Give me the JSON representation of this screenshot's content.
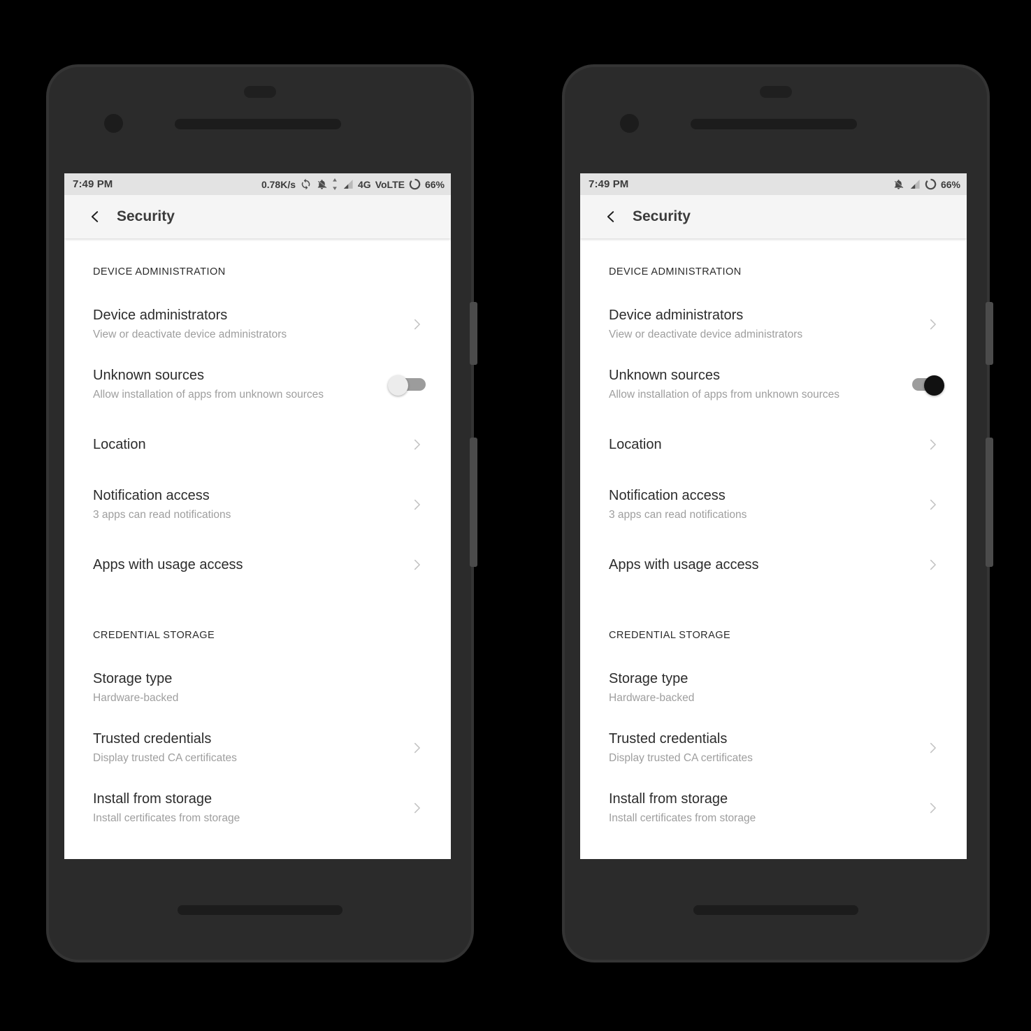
{
  "phones": [
    {
      "id": "phone-left",
      "status_bar": {
        "time": "7:49 PM",
        "data_speed": "0.78K/s",
        "network": "4G",
        "volte": "VoLTE",
        "battery": "66%",
        "icons": [
          "sync-icon",
          "bell-muted-icon",
          "data-arrows-icon",
          "signal-icon",
          "battery-icon"
        ]
      },
      "app_bar": {
        "back": "back-icon",
        "title": "Security"
      },
      "unknown_sources_enabled": false
    },
    {
      "id": "phone-right",
      "status_bar": {
        "time": "7:49 PM",
        "data_speed": "",
        "network": "",
        "volte": "",
        "battery": "66%",
        "icons": [
          "bell-muted-icon",
          "signal-icon",
          "battery-icon"
        ]
      },
      "app_bar": {
        "back": "back-icon",
        "title": "Security"
      },
      "unknown_sources_enabled": true
    }
  ],
  "sections": [
    {
      "header": "DEVICE ADMINISTRATION",
      "rows": [
        {
          "title": "Device administrators",
          "subtitle": "View or deactivate device administrators",
          "accessory": "chevron"
        },
        {
          "title": "Unknown sources",
          "subtitle": "Allow installation of apps from unknown sources",
          "accessory": "toggle"
        },
        {
          "title": "Location",
          "subtitle": "",
          "accessory": "chevron"
        },
        {
          "title": "Notification access",
          "subtitle": "3 apps can read notifications",
          "accessory": "chevron"
        },
        {
          "title": "Apps with usage access",
          "subtitle": "",
          "accessory": "chevron"
        }
      ]
    },
    {
      "header": "CREDENTIAL STORAGE",
      "rows": [
        {
          "title": "Storage type",
          "subtitle": "Hardware-backed",
          "accessory": "none"
        },
        {
          "title": "Trusted credentials",
          "subtitle": "Display trusted CA certificates",
          "accessory": "chevron"
        },
        {
          "title": "Install from storage",
          "subtitle": "Install certificates from storage",
          "accessory": "chevron"
        }
      ]
    }
  ],
  "colors": {
    "page_background": "#000000",
    "phone_body": "#2b2b2b",
    "status_bar": "#e3e3e3",
    "app_bar": "#f5f5f5",
    "content": "#ffffff",
    "title_text": "#2c2c2c",
    "subtitle_text": "#9e9e9e",
    "toggle_on_knob": "#111111",
    "toggle_off_knob": "#ececec",
    "toggle_track": "#9c9c9c"
  }
}
